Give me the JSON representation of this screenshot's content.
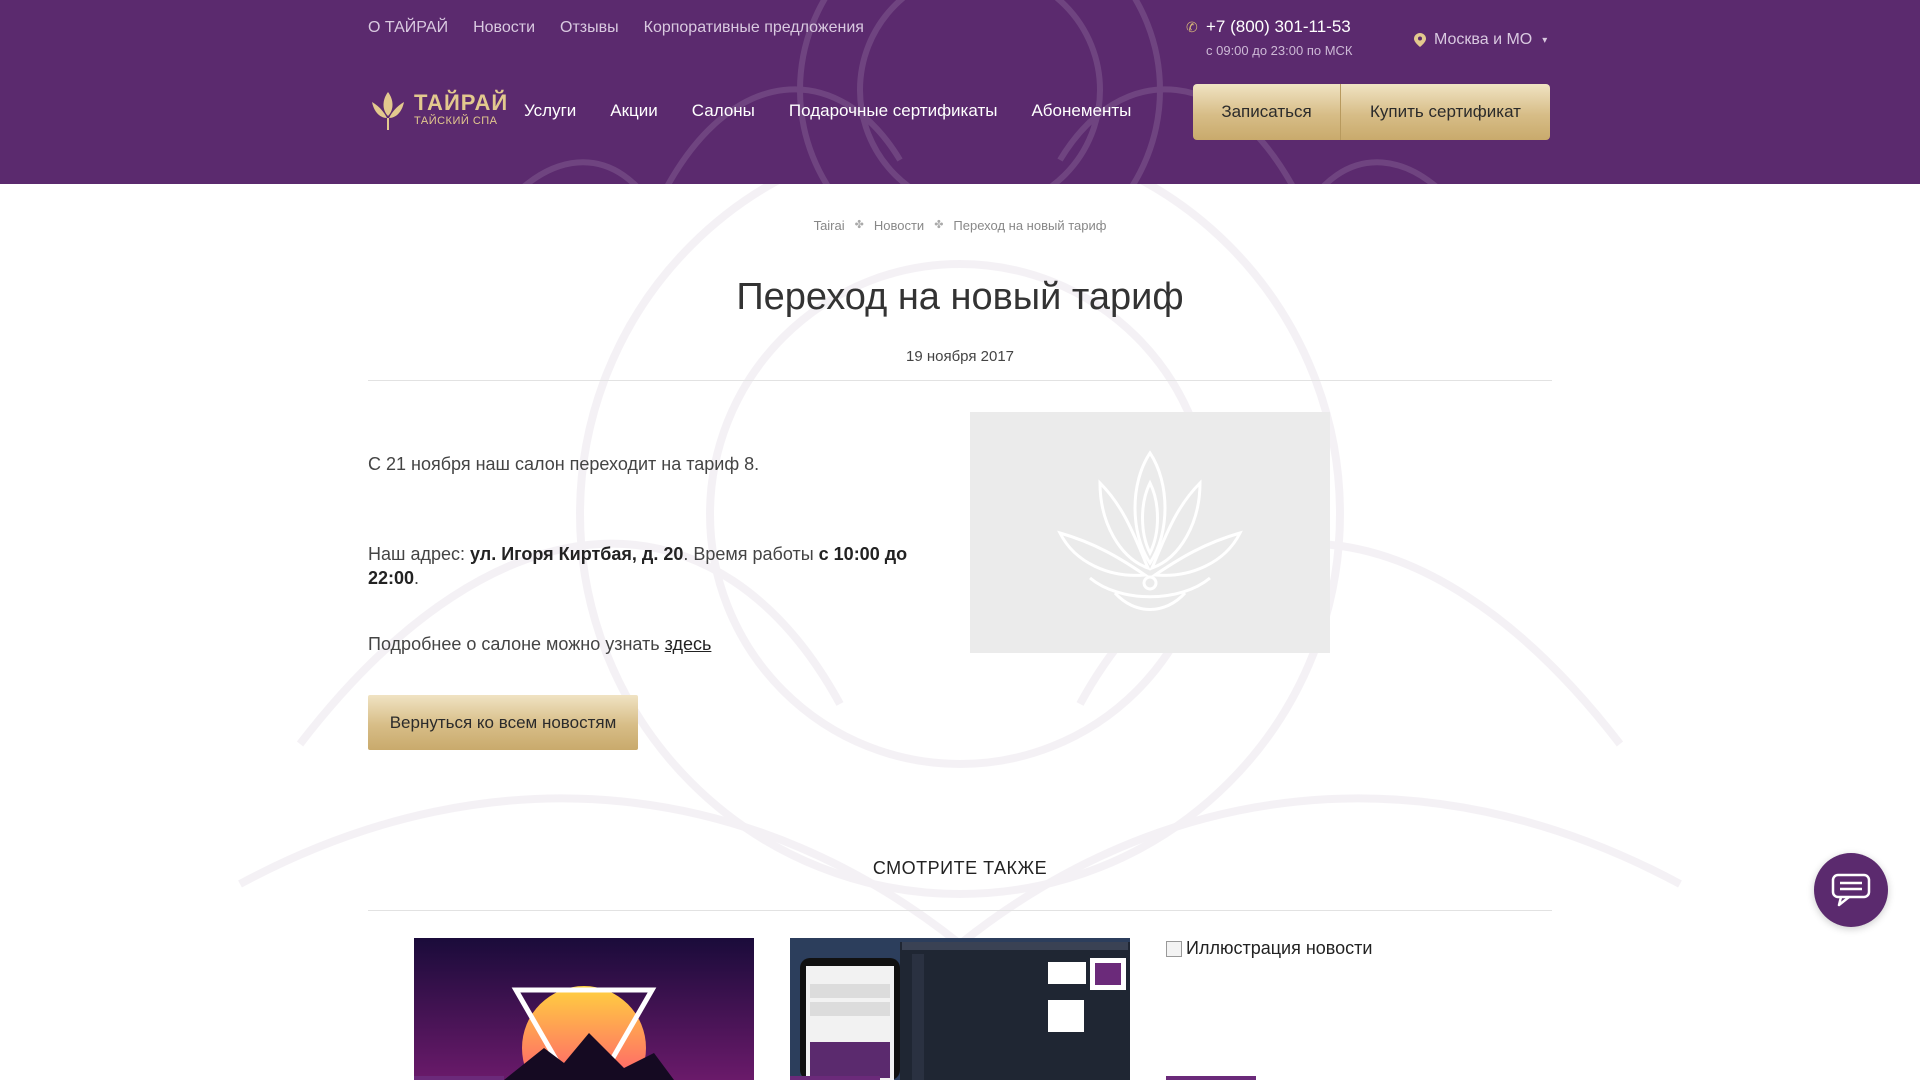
{
  "topnav": [
    "О ТАЙРАЙ",
    "Новости",
    "Отзывы",
    "Корпоративные предложения"
  ],
  "phone": {
    "number": "+7 (800) 301-11-53",
    "hours": "с 09:00 до 23:00 по МСК"
  },
  "city": "Москва и МО",
  "logo": {
    "main": "ТАЙРАЙ",
    "sub": "ТАЙСКИЙ СПА"
  },
  "mainnav": [
    "Услуги",
    "Акции",
    "Салоны",
    "Подарочные сертификаты",
    "Абонементы"
  ],
  "buttons": {
    "book": "Записаться",
    "certificate": "Купить сертификат",
    "back": "Вернуться ко всем новостям"
  },
  "breadcrumb": [
    "Tairai",
    "Новости",
    "Переход на новый тариф"
  ],
  "article": {
    "title": "Переход на новый тариф",
    "date": "19 ноября 2017",
    "p1": "С 21 ноября наш салон переходит на тариф 8.",
    "p2_prefix": "Наш адрес: ",
    "p2_address": "ул. Игоря Киртбая, д. 20",
    "p2_mid": ". Время работы ",
    "p2_hours": "с 10:00 до 22:00",
    "p2_suffix": ".",
    "p3_prefix": "Подробнее о салоне можно узнать ",
    "p3_link": "здесь"
  },
  "see_also": {
    "title": "СМОТРИТЕ ТАКЖЕ",
    "card3_alt": "Иллюстрация новости"
  },
  "colors": {
    "header_bg": "#5b2a6e",
    "gold": "#d7bd87",
    "accent": "#6b2a7a"
  }
}
